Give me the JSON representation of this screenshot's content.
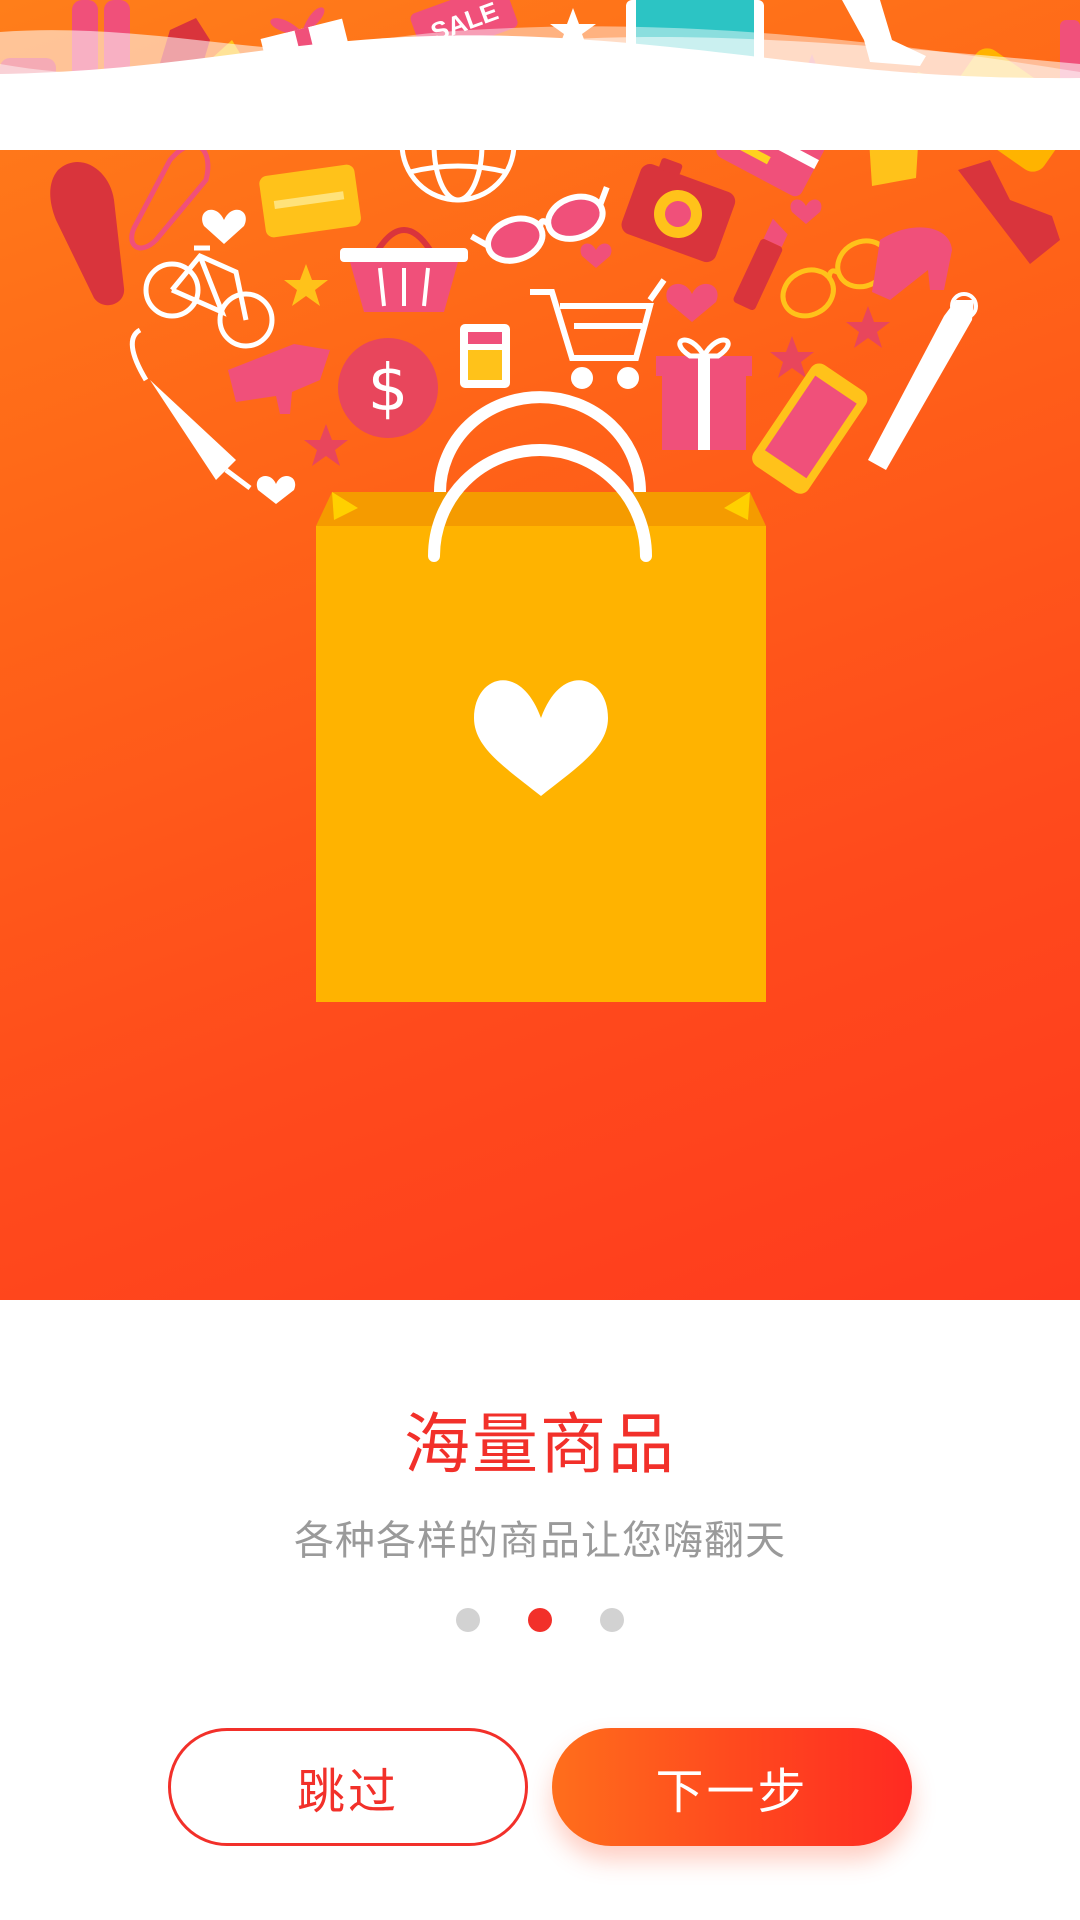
{
  "onboarding": {
    "title": "海量商品",
    "subtitle": "各种各样的商品让您嗨翻天",
    "pagination": {
      "total": 3,
      "current": 2
    },
    "buttons": {
      "skip_label": "跳过",
      "next_label": "下一步"
    },
    "illustration": {
      "sale_tag_text": "SALE",
      "dollar_text": "$"
    }
  },
  "colors": {
    "accent": "#f2302a",
    "gradient_start": "#ff7e1a",
    "gradient_end": "#ff3a1e",
    "bag": "#ffb300",
    "subtitle": "#9a9a9a",
    "dot_inactive": "#d2d2d2"
  }
}
